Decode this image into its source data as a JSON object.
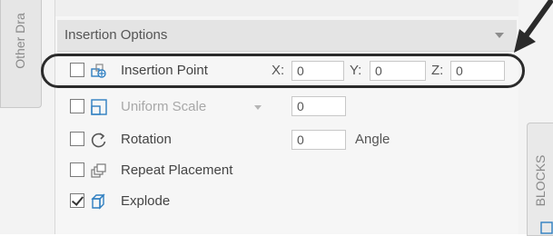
{
  "left_tab": {
    "label": "Other Dra"
  },
  "right_tab": {
    "label": "BLOCKS"
  },
  "section": {
    "title": "Insertion Options"
  },
  "insertion_point": {
    "label": "Insertion Point",
    "checked": false,
    "x_label": "X:",
    "x_value": "0",
    "y_label": "Y:",
    "y_value": "0",
    "z_label": "Z:",
    "z_value": "0",
    "icon": "insertion-point-icon"
  },
  "scale": {
    "selected": "Uniform Scale",
    "value": "0",
    "checked": false,
    "icon": "scale-icon"
  },
  "rotation": {
    "label": "Rotation",
    "value": "0",
    "unit": "Angle",
    "checked": false,
    "icon": "rotation-icon"
  },
  "repeat": {
    "label": "Repeat Placement",
    "checked": false,
    "icon": "repeat-placement-icon"
  },
  "explode": {
    "label": "Explode",
    "checked": true,
    "icon": "explode-icon"
  },
  "colors": {
    "icon_blue": "#2f7fc1",
    "oval": "#2a2a2a",
    "header_bg": "#e4e4e4"
  }
}
